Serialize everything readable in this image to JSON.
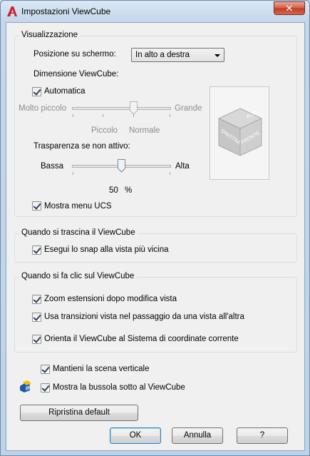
{
  "window": {
    "title": "Impostazioni ViewCube",
    "close_glyph": "✕"
  },
  "display": {
    "group_title": "Visualizzazione",
    "position_label": "Posizione su schermo:",
    "position_value": "In alto a destra",
    "size_label": "Dimensione ViewCube:",
    "automatic_label": "Automatica",
    "automatic_checked": true,
    "size_slider": {
      "min_label": "Molto piccolo",
      "max_label": "Grande",
      "small_label": "Piccolo",
      "normal_label": "Normale",
      "enabled": false
    },
    "transparency_label": "Trasparenza se non attivo:",
    "transparency_slider": {
      "min_label": "Bassa",
      "max_label": "Alta",
      "value_text": "50",
      "unit": "%",
      "level": 0.5
    },
    "show_ucs_label": "Mostra menu UCS",
    "show_ucs_checked": true,
    "preview_cube": {
      "top": "ALTO",
      "left": "SINISTRA",
      "front": "FRONTE"
    }
  },
  "drag": {
    "group_title": "Quando si trascina il ViewCube",
    "snap_label": "Esegui lo snap alla vista più vicina",
    "snap_checked": true
  },
  "click": {
    "group_title": "Quando si fa clic sul ViewCube",
    "zoom_label": "Zoom estensioni dopo modifica vista",
    "transition_label": "Usa transizioni vista nel passaggio da una vista all'altra",
    "orient_label": "Orienta il ViewCube al Sistema di coordinate corrente"
  },
  "options": {
    "keep_upright_label": "Mantieni la scena verticale",
    "show_compass_label": "Mostra la bussola sotto al ViewCube"
  },
  "buttons": {
    "restore_default": "Ripristina default",
    "ok": "OK",
    "cancel": "Annulla",
    "help": "?"
  },
  "colors": {
    "accent": "#3c7fb1",
    "title_bar": "#c4d6eb",
    "app_icon_red": "#c8202a"
  }
}
